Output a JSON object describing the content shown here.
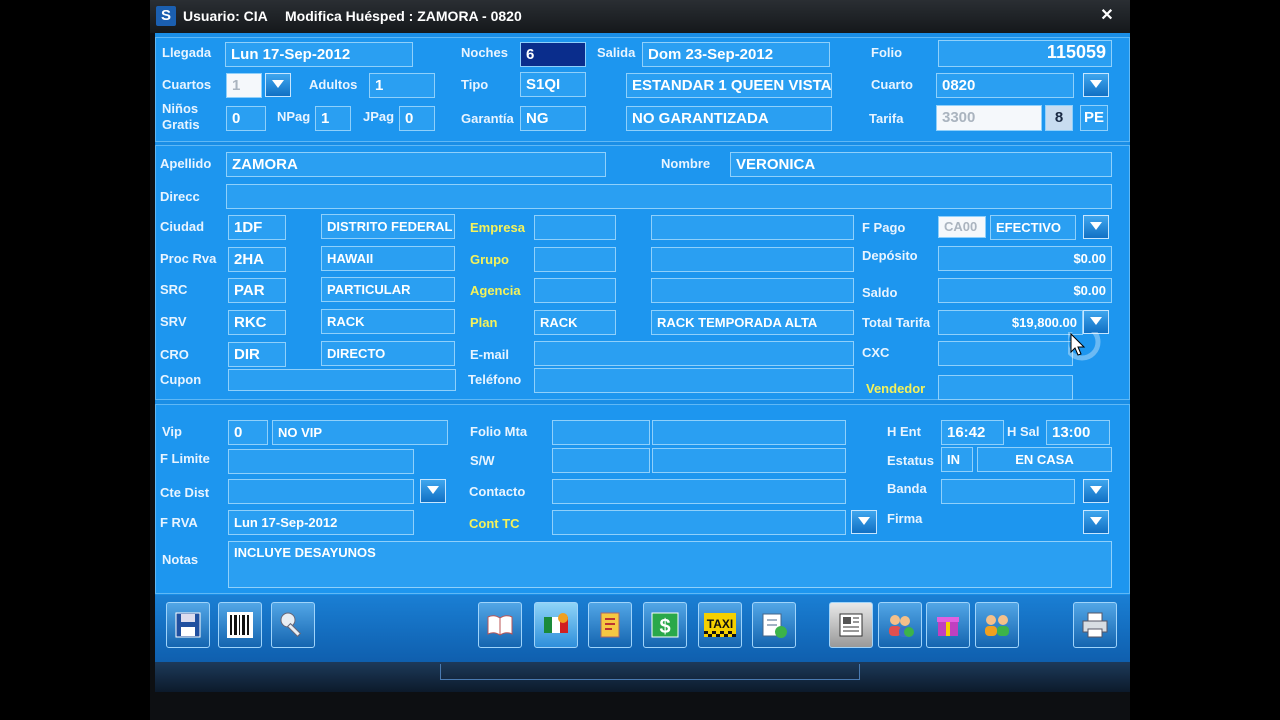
{
  "titlebar": {
    "user_label": "Usuario: CIA",
    "form_title": "Modifica Huésped : ZAMORA  -  0820",
    "close": "✕"
  },
  "top": {
    "llegada_label": "Llegada",
    "llegada": "Lun 17-Sep-2012",
    "noches_label": "Noches",
    "noches": "6",
    "salida_label": "Salida",
    "salida": "Dom 23-Sep-2012",
    "folio_label": "Folio",
    "folio": "115059",
    "cuartos_label": "Cuartos",
    "cuartos": "1",
    "adultos_label": "Adultos",
    "adultos": "1",
    "tipo_label": "Tipo",
    "tipo_code": "S1QI",
    "tipo_desc": "ESTANDAR 1 QUEEN VISTA",
    "cuarto_label": "Cuarto",
    "cuarto": "0820",
    "ninos_label": "Niños Gratis",
    "ninos": "0",
    "npag_label": "NPag",
    "npag": "1",
    "jpag_label": "JPag",
    "jpag": "0",
    "garantia_label": "Garantía",
    "garantia_code": "NG",
    "garantia_desc": "NO GARANTIZADA",
    "tarifa_label": "Tarifa",
    "tarifa": "3300",
    "tarifa_num": "8",
    "tarifa_pe": "PE"
  },
  "guest": {
    "apellido_label": "Apellido",
    "apellido": "ZAMORA",
    "nombre_label": "Nombre",
    "nombre": "VERONICA",
    "direcc_label": "Direcc",
    "direcc": "",
    "ciudad_label": "Ciudad",
    "ciudad_code": "1DF",
    "ciudad_desc": "DISTRITO FEDERAL",
    "procrva_label": "Proc Rva",
    "procrva_code": "2HA",
    "procrva_desc": "HAWAII",
    "src_label": "SRC",
    "src_code": "PAR",
    "src_desc": "PARTICULAR",
    "srv_label": "SRV",
    "srv_code": "RKC",
    "srv_desc": "RACK",
    "cro_label": "CRO",
    "cro_code": "DIR",
    "cro_desc": "DIRECTO",
    "cupon_label": "Cupon",
    "empresa_label": "Empresa",
    "grupo_label": "Grupo",
    "agencia_label": "Agencia",
    "plan_label": "Plan",
    "plan_code": "RACK",
    "plan_desc": "RACK TEMPORADA ALTA",
    "email_label": "E-mail",
    "telefono_label": "Teléfono",
    "fpago_label": "F Pago",
    "fpago_code": "CA00",
    "fpago_desc": "EFECTIVO",
    "deposito_label": "Depósito",
    "deposito": "$0.00",
    "saldo_label": "Saldo",
    "saldo": "$0.00",
    "total_label": "Total Tarifa",
    "total": "$19,800.00",
    "cxc_label": "CXC",
    "vendedor_label": "Vendedor"
  },
  "bottom": {
    "vip_label": "Vip",
    "vip_code": "0",
    "vip_desc": "NO VIP",
    "flimite_label": "F Limite",
    "ctedist_label": "Cte Dist",
    "frva_label": "F RVA",
    "frva": "Lun 17-Sep-2012",
    "notas_label": "Notas",
    "notas": "INCLUYE DESAYUNOS",
    "foliomta_label": "Folio Mta",
    "sw_label": "S/W",
    "contacto_label": "Contacto",
    "conttc_label": "Cont TC",
    "hent_label": "H Ent",
    "hent": "16:42",
    "hsal_label": "H Sal",
    "hsal": "13:00",
    "estatus_label": "Estatus",
    "estatus_code": "IN",
    "estatus_desc": "EN CASA",
    "banda_label": "Banda",
    "firma_label": "Firma",
    "taxi_label": "TAXI"
  },
  "colors": {
    "panel": "#1d96ef",
    "field": "#2a9ff2",
    "label_yellow": "#f5f25a",
    "selected": "#0a2d8c"
  }
}
